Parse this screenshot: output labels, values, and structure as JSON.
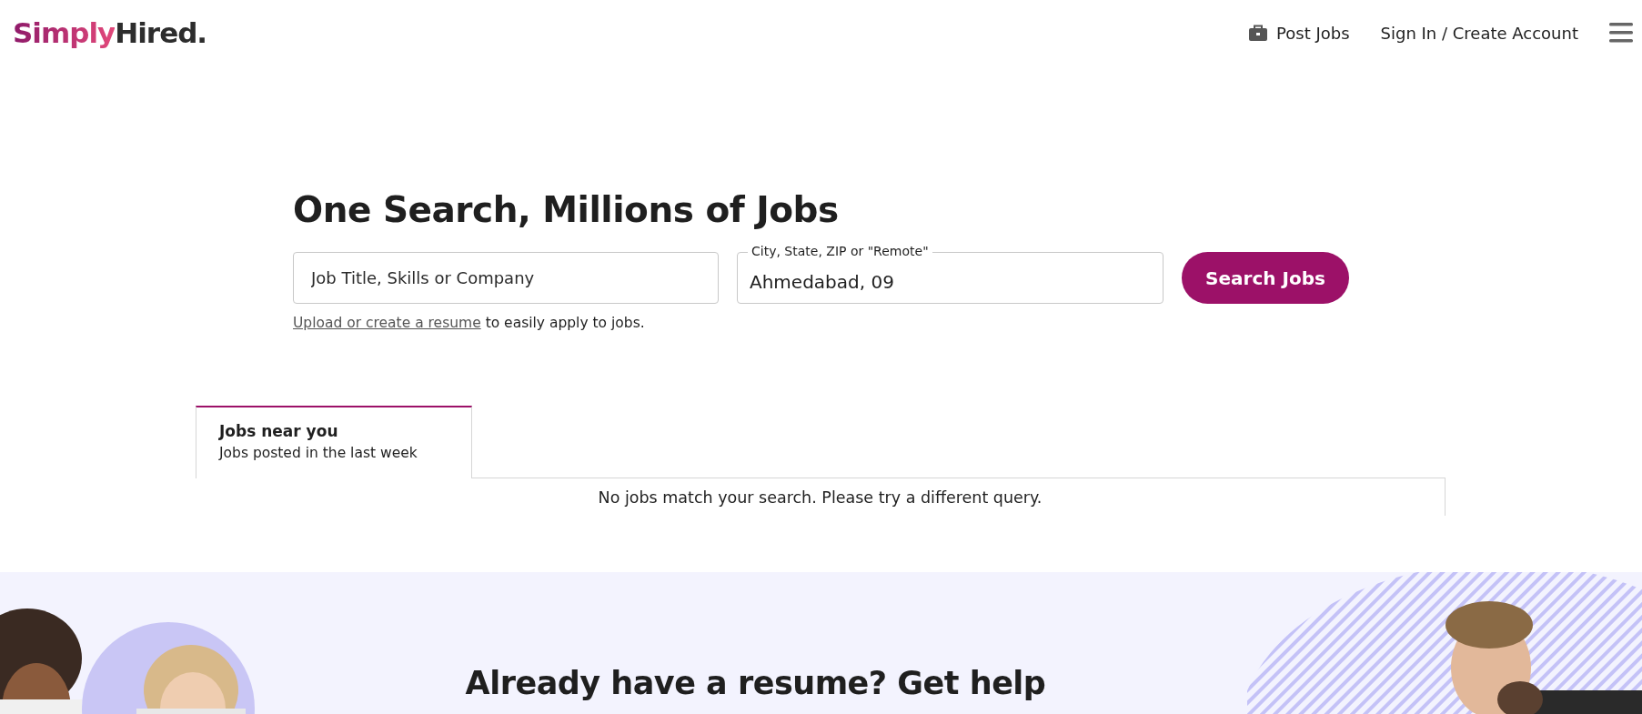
{
  "header": {
    "logo_primary": "Simply",
    "logo_secondary": "Hired",
    "logo_dot": ".",
    "nav": [
      {
        "label": "Post Jobs",
        "kind": "post"
      },
      {
        "label": "Sign In / Create Account",
        "kind": "plain"
      }
    ]
  },
  "search": {
    "title": "One Search, Millions of Jobs",
    "what": {
      "placeholder": "Job Title, Skills or Company"
    },
    "where": {
      "label": "City, State, ZIP or \"Remote\"",
      "value": "Ahmedabad, 09"
    },
    "button": "Search Jobs",
    "hint_link": "Upload or create a resume",
    "hint_text": "to easily apply to jobs."
  },
  "tabs": [
    {
      "title": "Jobs near you",
      "subtitle": "Jobs posted in the last week",
      "selected": true
    }
  ],
  "results": {
    "message": "No jobs match your search. Please try a different query."
  },
  "promo": {
    "heading": "Already have a resume? Get help"
  }
}
